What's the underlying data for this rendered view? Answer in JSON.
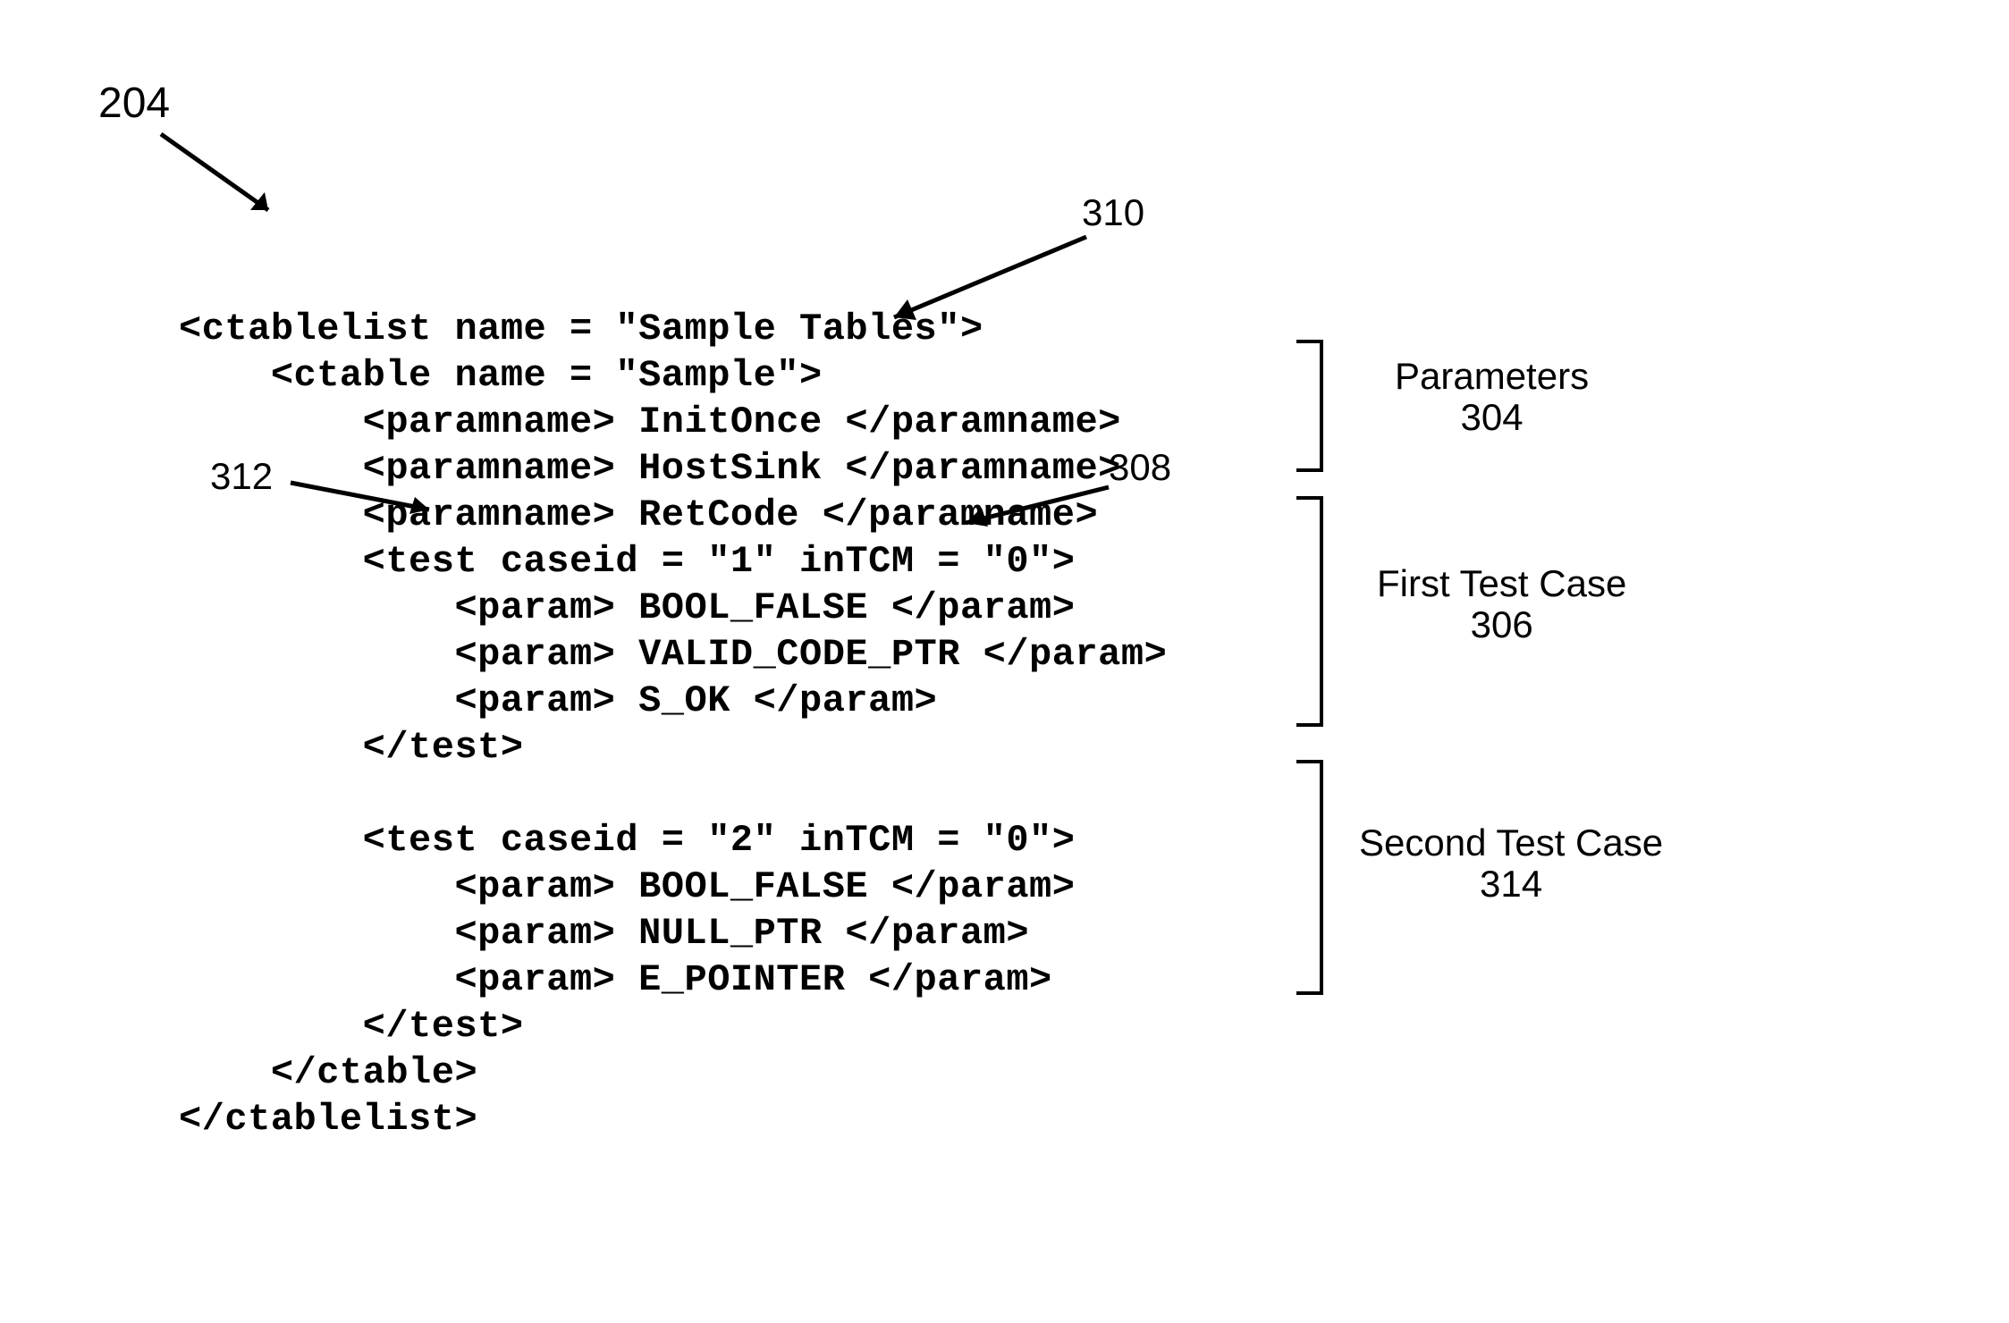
{
  "ref_numbers": {
    "n204": "204",
    "n310": "310",
    "n312": "312",
    "n308": "308",
    "n304": "304",
    "n306": "306",
    "n314": "314"
  },
  "bracket_labels": {
    "params_label_line1": "Parameters",
    "params_label_line2": "304",
    "tc1_label_line1": "First Test Case",
    "tc1_label_line2": "306",
    "tc2_label_line1": "Second Test Case",
    "tc2_label_line2": "314"
  },
  "code": {
    "l01": "<ctablelist name = \"Sample Tables\">",
    "l02": "    <ctable name = \"Sample\">",
    "l03": "        <paramname> InitOnce </paramname>",
    "l04": "        <paramname> HostSink </paramname>",
    "l05": "        <paramname> RetCode </paramname>",
    "l06": "",
    "l07": "        <test caseid = \"1\" inTCM = \"0\">",
    "l08": "            <param> BOOL_FALSE </param>",
    "l09": "            <param> VALID_CODE_PTR </param>",
    "l10": "            <param> S_OK </param>",
    "l11": "        </test>",
    "l12": "",
    "l13": "        <test caseid = \"2\" inTCM = \"0\">",
    "l14": "            <param> BOOL_FALSE </param>",
    "l15": "            <param> NULL_PTR </param>",
    "l16": "            <param> E_POINTER </param>",
    "l17": "        </test>",
    "l18": "    </ctable>",
    "l19": "</ctablelist>"
  }
}
